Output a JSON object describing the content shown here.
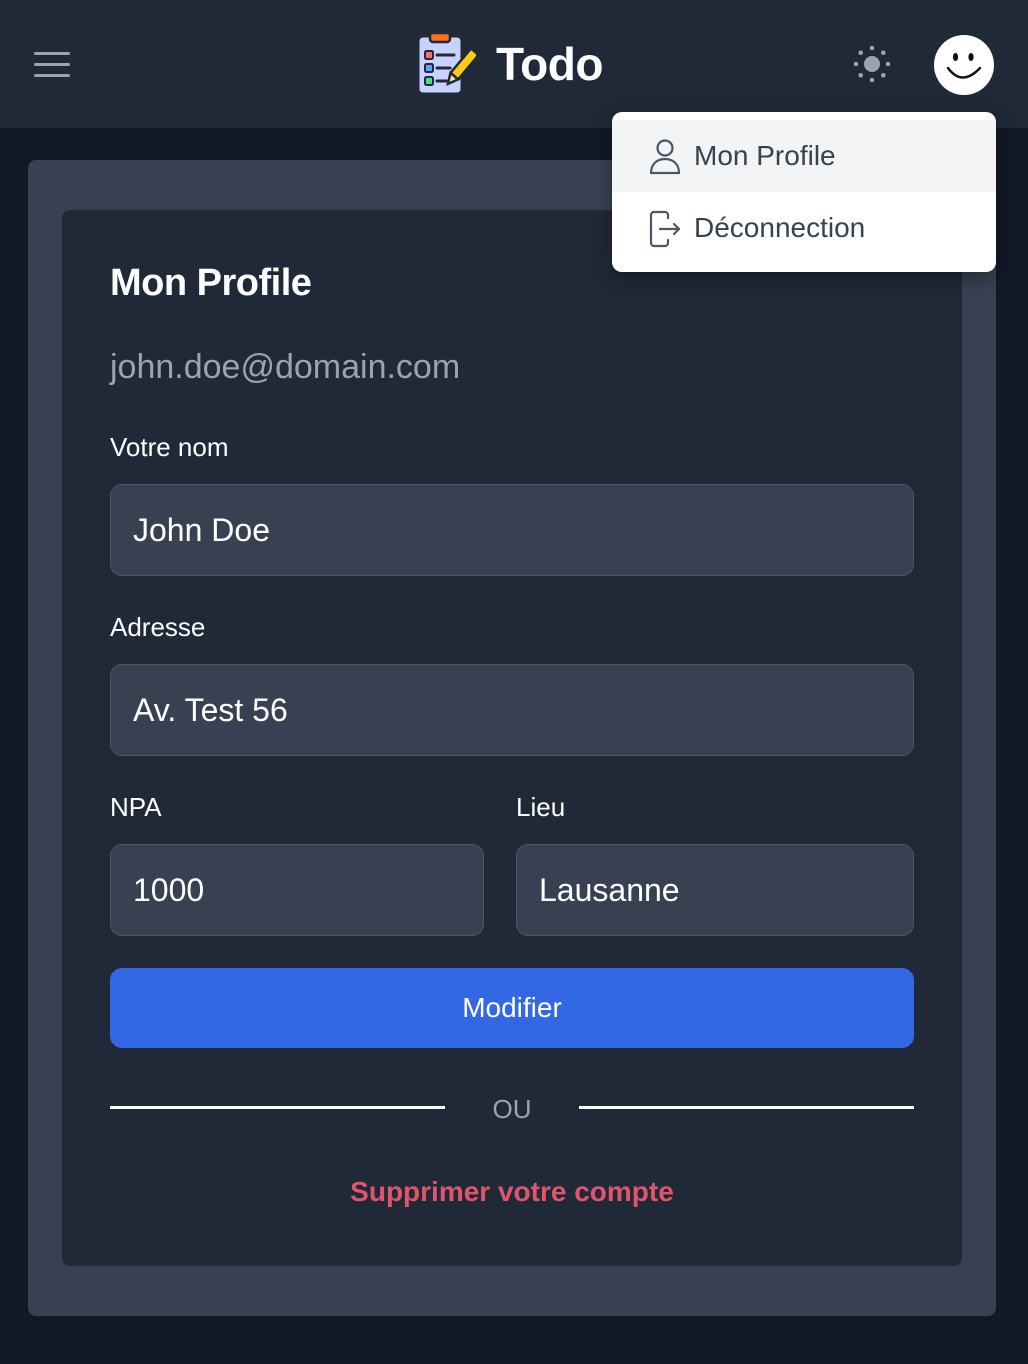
{
  "header": {
    "menu_icon": "hamburger-menu-icon",
    "logo_icon": "todo-checklist-logo-icon",
    "title": "Todo",
    "theme_icon": "sun-icon",
    "avatar_icon": "smiley-avatar-icon"
  },
  "dropdown": {
    "items": [
      {
        "label": "Mon Profile",
        "icon": "user-icon"
      },
      {
        "label": "Déconnection",
        "icon": "logout-icon"
      }
    ]
  },
  "profile": {
    "title": "Mon Profile",
    "email": "john.doe@domain.com",
    "name_label": "Votre nom",
    "name_value": "John Doe",
    "address_label": "Adresse",
    "address_value": "Av. Test 56",
    "npa_label": "NPA",
    "npa_value": "1000",
    "city_label": "Lieu",
    "city_value": "Lausanne",
    "submit_label": "Modifier",
    "divider_text": "OU",
    "delete_label": "Supprimer votre compte"
  },
  "colors": {
    "page_bg": "#111827",
    "header_bg": "#1f2937",
    "outer_card_bg": "#374151",
    "inner_card_bg": "#1f2937",
    "primary": "#3367e3",
    "danger": "#e0556b"
  }
}
